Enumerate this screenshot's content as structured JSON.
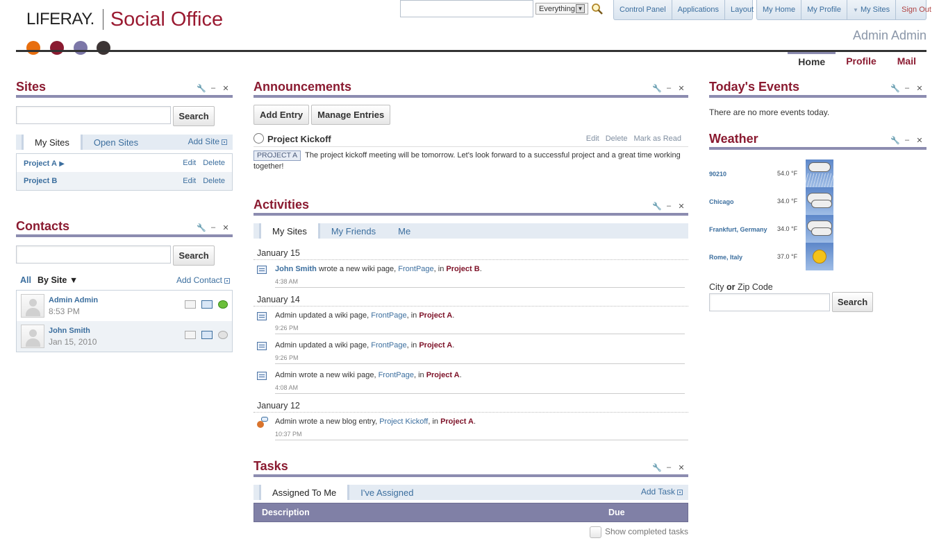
{
  "header": {
    "logo_left": "LIFERAY.",
    "logo_right": "Social Office",
    "scope": "Everything",
    "admin_nav": [
      "Control Panel",
      "Applications",
      "Layout"
    ],
    "user_nav": [
      "My Home",
      "My Profile",
      "My Sites",
      "Sign Out"
    ],
    "user_name": "Admin Admin",
    "page_tabs": [
      "Home",
      "Profile",
      "Mail"
    ],
    "dot_colors": [
      "#e86e0e",
      "#8a1a30",
      "#7c77a8",
      "#3d3535"
    ]
  },
  "sites": {
    "title": "Sites",
    "search_button": "Search",
    "tabs": [
      "My Sites",
      "Open Sites"
    ],
    "add_site": "Add Site",
    "rows": [
      {
        "name": "Project A",
        "edit": "Edit",
        "delete": "Delete"
      },
      {
        "name": "Project B",
        "edit": "Edit",
        "delete": "Delete"
      }
    ]
  },
  "contacts": {
    "title": "Contacts",
    "search_button": "Search",
    "filter_all": "All",
    "filter_by_site": "By Site",
    "add_contact": "Add Contact",
    "rows": [
      {
        "name": "Admin Admin",
        "sub": "8:53 PM"
      },
      {
        "name": "John Smith",
        "sub": "Jan 15, 2010"
      }
    ]
  },
  "announcements": {
    "title": "Announcements",
    "add_entry": "Add Entry",
    "manage_entries": "Manage Entries",
    "entry": {
      "title": "Project Kickoff",
      "edit": "Edit",
      "delete": "Delete",
      "mark_read": "Mark as Read",
      "tag": "PROJECT A",
      "body1": "The project kickoff meeting will be tomorrow. Let's look forward to a successful project and a great time working",
      "body2": "together!"
    }
  },
  "activities": {
    "title": "Activities",
    "tabs": [
      "My Sites",
      "My Friends",
      "Me"
    ],
    "dates": [
      "January 15",
      "January 14",
      "January 12"
    ],
    "items": [
      {
        "actor": "John Smith",
        "verb": " wrote a new wiki page, ",
        "object": "FrontPage",
        "mid": ", in ",
        "site": "Project B",
        "end": ".",
        "time": "4:38 AM"
      },
      {
        "actor": "Admin",
        "verb": " updated a wiki page, ",
        "object": "FrontPage",
        "mid": ", in ",
        "site": "Project A",
        "end": ".",
        "time": "9:26 PM"
      },
      {
        "actor": "Admin",
        "verb": " updated a wiki page, ",
        "object": "FrontPage",
        "mid": ", in ",
        "site": "Project A",
        "end": ".",
        "time": "9:26 PM"
      },
      {
        "actor": "Admin",
        "verb": " wrote a new wiki page, ",
        "object": "FrontPage",
        "mid": ", in ",
        "site": "Project A",
        "end": ".",
        "time": "4:08 AM"
      },
      {
        "actor": "Admin",
        "verb": " wrote a new blog entry, ",
        "object": "Project Kickoff",
        "mid": ", in ",
        "site": "Project A",
        "end": ".",
        "time": "10:37 PM"
      }
    ]
  },
  "tasks": {
    "title": "Tasks",
    "tabs": [
      "Assigned To Me",
      "I've Assigned"
    ],
    "add_task": "Add Task",
    "col_description": "Description",
    "col_due": "Due",
    "show_completed": "Show completed tasks"
  },
  "events": {
    "title": "Today's Events",
    "empty": "There are no more events today."
  },
  "weather": {
    "title": "Weather",
    "rows": [
      {
        "city": "90210",
        "temp": "54.0 °F",
        "icon": "rain-icon"
      },
      {
        "city": "Chicago",
        "temp": "34.0 °F",
        "icon": "cloudy-icon"
      },
      {
        "city": "Frankfurt, Germany",
        "temp": "34.0 °F",
        "icon": "cloudy-icon"
      },
      {
        "city": "Rome, Italy",
        "temp": "37.0 °F",
        "icon": "sunny-icon"
      }
    ],
    "label_city": "City",
    "label_or": "or",
    "label_zip": "Zip Code",
    "search_button": "Search"
  }
}
